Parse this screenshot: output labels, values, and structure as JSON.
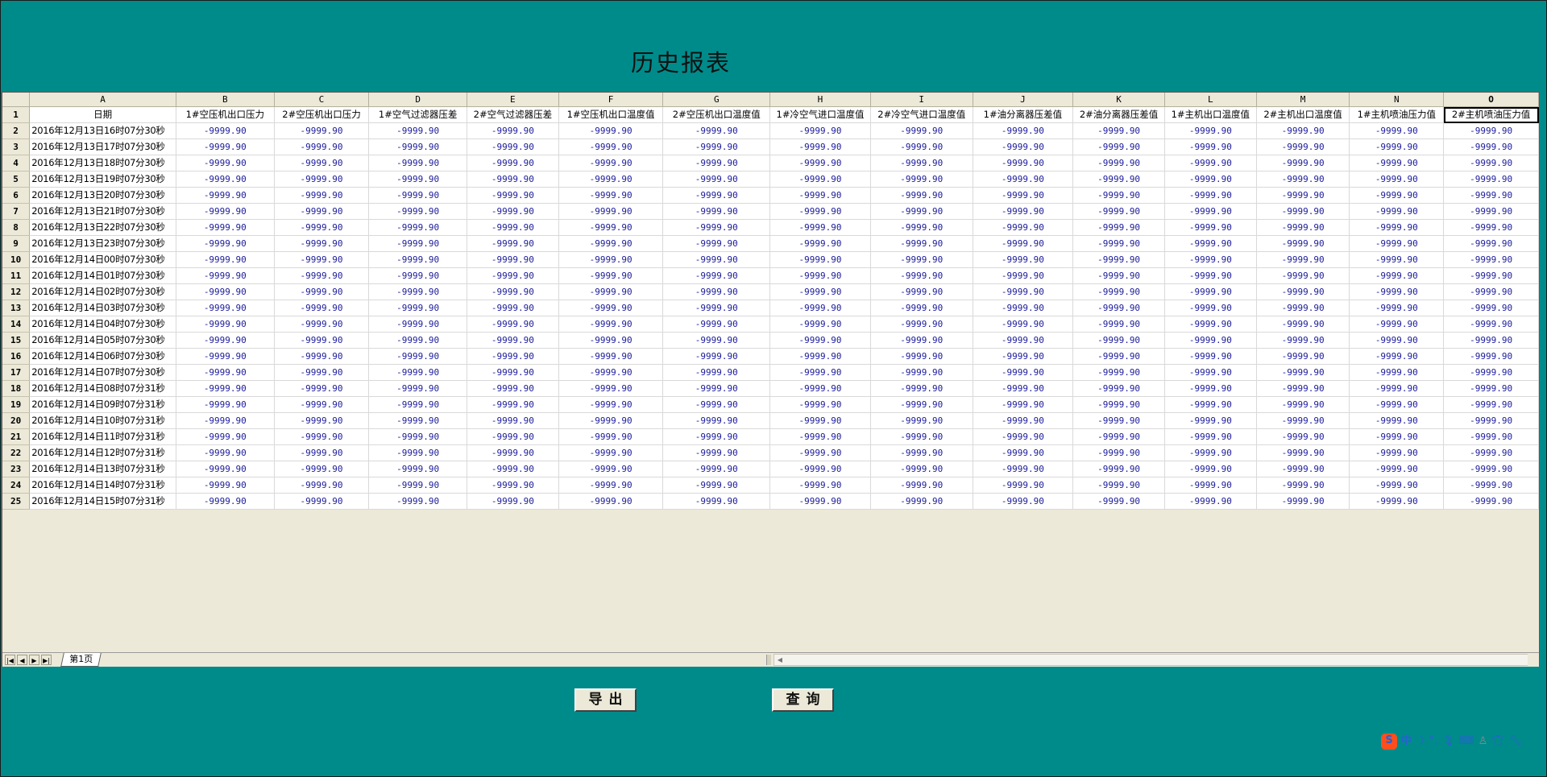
{
  "page": {
    "title": "历史报表"
  },
  "sheet": {
    "column_letters": [
      "A",
      "B",
      "C",
      "D",
      "E",
      "F",
      "G",
      "H",
      "I",
      "J",
      "K",
      "L",
      "M",
      "N",
      "O"
    ],
    "headers": [
      "日期",
      "1#空压机出口压力",
      "2#空压机出口压力",
      "1#空气过滤器压差",
      "2#空气过滤器压差",
      "1#空压机出口温度值",
      "2#空压机出口温度值",
      "1#冷空气进口温度值",
      "2#冷空气进口温度值",
      "1#油分离器压差值",
      "2#油分离器压差值",
      "1#主机出口温度值",
      "2#主机出口温度值",
      "1#主机喷油压力值",
      "2#主机喷油压力值"
    ],
    "rows": [
      {
        "num": "2",
        "date": "2016年12月13日16时07分30秒",
        "values": [
          "-9999.90",
          "-9999.90",
          "-9999.90",
          "-9999.90",
          "-9999.90",
          "-9999.90",
          "-9999.90",
          "-9999.90",
          "-9999.90",
          "-9999.90",
          "-9999.90",
          "-9999.90",
          "-9999.90",
          "-9999.90"
        ]
      },
      {
        "num": "3",
        "date": "2016年12月13日17时07分30秒",
        "values": [
          "-9999.90",
          "-9999.90",
          "-9999.90",
          "-9999.90",
          "-9999.90",
          "-9999.90",
          "-9999.90",
          "-9999.90",
          "-9999.90",
          "-9999.90",
          "-9999.90",
          "-9999.90",
          "-9999.90",
          "-9999.90"
        ]
      },
      {
        "num": "4",
        "date": "2016年12月13日18时07分30秒",
        "values": [
          "-9999.90",
          "-9999.90",
          "-9999.90",
          "-9999.90",
          "-9999.90",
          "-9999.90",
          "-9999.90",
          "-9999.90",
          "-9999.90",
          "-9999.90",
          "-9999.90",
          "-9999.90",
          "-9999.90",
          "-9999.90"
        ]
      },
      {
        "num": "5",
        "date": "2016年12月13日19时07分30秒",
        "values": [
          "-9999.90",
          "-9999.90",
          "-9999.90",
          "-9999.90",
          "-9999.90",
          "-9999.90",
          "-9999.90",
          "-9999.90",
          "-9999.90",
          "-9999.90",
          "-9999.90",
          "-9999.90",
          "-9999.90",
          "-9999.90"
        ]
      },
      {
        "num": "6",
        "date": "2016年12月13日20时07分30秒",
        "values": [
          "-9999.90",
          "-9999.90",
          "-9999.90",
          "-9999.90",
          "-9999.90",
          "-9999.90",
          "-9999.90",
          "-9999.90",
          "-9999.90",
          "-9999.90",
          "-9999.90",
          "-9999.90",
          "-9999.90",
          "-9999.90"
        ]
      },
      {
        "num": "7",
        "date": "2016年12月13日21时07分30秒",
        "values": [
          "-9999.90",
          "-9999.90",
          "-9999.90",
          "-9999.90",
          "-9999.90",
          "-9999.90",
          "-9999.90",
          "-9999.90",
          "-9999.90",
          "-9999.90",
          "-9999.90",
          "-9999.90",
          "-9999.90",
          "-9999.90"
        ]
      },
      {
        "num": "8",
        "date": "2016年12月13日22时07分30秒",
        "values": [
          "-9999.90",
          "-9999.90",
          "-9999.90",
          "-9999.90",
          "-9999.90",
          "-9999.90",
          "-9999.90",
          "-9999.90",
          "-9999.90",
          "-9999.90",
          "-9999.90",
          "-9999.90",
          "-9999.90",
          "-9999.90"
        ]
      },
      {
        "num": "9",
        "date": "2016年12月13日23时07分30秒",
        "values": [
          "-9999.90",
          "-9999.90",
          "-9999.90",
          "-9999.90",
          "-9999.90",
          "-9999.90",
          "-9999.90",
          "-9999.90",
          "-9999.90",
          "-9999.90",
          "-9999.90",
          "-9999.90",
          "-9999.90",
          "-9999.90"
        ]
      },
      {
        "num": "10",
        "date": "2016年12月14日00时07分30秒",
        "values": [
          "-9999.90",
          "-9999.90",
          "-9999.90",
          "-9999.90",
          "-9999.90",
          "-9999.90",
          "-9999.90",
          "-9999.90",
          "-9999.90",
          "-9999.90",
          "-9999.90",
          "-9999.90",
          "-9999.90",
          "-9999.90"
        ]
      },
      {
        "num": "11",
        "date": "2016年12月14日01时07分30秒",
        "values": [
          "-9999.90",
          "-9999.90",
          "-9999.90",
          "-9999.90",
          "-9999.90",
          "-9999.90",
          "-9999.90",
          "-9999.90",
          "-9999.90",
          "-9999.90",
          "-9999.90",
          "-9999.90",
          "-9999.90",
          "-9999.90"
        ]
      },
      {
        "num": "12",
        "date": "2016年12月14日02时07分30秒",
        "values": [
          "-9999.90",
          "-9999.90",
          "-9999.90",
          "-9999.90",
          "-9999.90",
          "-9999.90",
          "-9999.90",
          "-9999.90",
          "-9999.90",
          "-9999.90",
          "-9999.90",
          "-9999.90",
          "-9999.90",
          "-9999.90"
        ]
      },
      {
        "num": "13",
        "date": "2016年12月14日03时07分30秒",
        "values": [
          "-9999.90",
          "-9999.90",
          "-9999.90",
          "-9999.90",
          "-9999.90",
          "-9999.90",
          "-9999.90",
          "-9999.90",
          "-9999.90",
          "-9999.90",
          "-9999.90",
          "-9999.90",
          "-9999.90",
          "-9999.90"
        ]
      },
      {
        "num": "14",
        "date": "2016年12月14日04时07分30秒",
        "values": [
          "-9999.90",
          "-9999.90",
          "-9999.90",
          "-9999.90",
          "-9999.90",
          "-9999.90",
          "-9999.90",
          "-9999.90",
          "-9999.90",
          "-9999.90",
          "-9999.90",
          "-9999.90",
          "-9999.90",
          "-9999.90"
        ]
      },
      {
        "num": "15",
        "date": "2016年12月14日05时07分30秒",
        "values": [
          "-9999.90",
          "-9999.90",
          "-9999.90",
          "-9999.90",
          "-9999.90",
          "-9999.90",
          "-9999.90",
          "-9999.90",
          "-9999.90",
          "-9999.90",
          "-9999.90",
          "-9999.90",
          "-9999.90",
          "-9999.90"
        ]
      },
      {
        "num": "16",
        "date": "2016年12月14日06时07分30秒",
        "values": [
          "-9999.90",
          "-9999.90",
          "-9999.90",
          "-9999.90",
          "-9999.90",
          "-9999.90",
          "-9999.90",
          "-9999.90",
          "-9999.90",
          "-9999.90",
          "-9999.90",
          "-9999.90",
          "-9999.90",
          "-9999.90"
        ]
      },
      {
        "num": "17",
        "date": "2016年12月14日07时07分30秒",
        "values": [
          "-9999.90",
          "-9999.90",
          "-9999.90",
          "-9999.90",
          "-9999.90",
          "-9999.90",
          "-9999.90",
          "-9999.90",
          "-9999.90",
          "-9999.90",
          "-9999.90",
          "-9999.90",
          "-9999.90",
          "-9999.90"
        ]
      },
      {
        "num": "18",
        "date": "2016年12月14日08时07分31秒",
        "values": [
          "-9999.90",
          "-9999.90",
          "-9999.90",
          "-9999.90",
          "-9999.90",
          "-9999.90",
          "-9999.90",
          "-9999.90",
          "-9999.90",
          "-9999.90",
          "-9999.90",
          "-9999.90",
          "-9999.90",
          "-9999.90"
        ]
      },
      {
        "num": "19",
        "date": "2016年12月14日09时07分31秒",
        "values": [
          "-9999.90",
          "-9999.90",
          "-9999.90",
          "-9999.90",
          "-9999.90",
          "-9999.90",
          "-9999.90",
          "-9999.90",
          "-9999.90",
          "-9999.90",
          "-9999.90",
          "-9999.90",
          "-9999.90",
          "-9999.90"
        ]
      },
      {
        "num": "20",
        "date": "2016年12月14日10时07分31秒",
        "values": [
          "-9999.90",
          "-9999.90",
          "-9999.90",
          "-9999.90",
          "-9999.90",
          "-9999.90",
          "-9999.90",
          "-9999.90",
          "-9999.90",
          "-9999.90",
          "-9999.90",
          "-9999.90",
          "-9999.90",
          "-9999.90"
        ]
      },
      {
        "num": "21",
        "date": "2016年12月14日11时07分31秒",
        "values": [
          "-9999.90",
          "-9999.90",
          "-9999.90",
          "-9999.90",
          "-9999.90",
          "-9999.90",
          "-9999.90",
          "-9999.90",
          "-9999.90",
          "-9999.90",
          "-9999.90",
          "-9999.90",
          "-9999.90",
          "-9999.90"
        ]
      },
      {
        "num": "22",
        "date": "2016年12月14日12时07分31秒",
        "values": [
          "-9999.90",
          "-9999.90",
          "-9999.90",
          "-9999.90",
          "-9999.90",
          "-9999.90",
          "-9999.90",
          "-9999.90",
          "-9999.90",
          "-9999.90",
          "-9999.90",
          "-9999.90",
          "-9999.90",
          "-9999.90"
        ]
      },
      {
        "num": "23",
        "date": "2016年12月14日13时07分31秒",
        "values": [
          "-9999.90",
          "-9999.90",
          "-9999.90",
          "-9999.90",
          "-9999.90",
          "-9999.90",
          "-9999.90",
          "-9999.90",
          "-9999.90",
          "-9999.90",
          "-9999.90",
          "-9999.90",
          "-9999.90",
          "-9999.90"
        ]
      },
      {
        "num": "24",
        "date": "2016年12月14日14时07分31秒",
        "values": [
          "-9999.90",
          "-9999.90",
          "-9999.90",
          "-9999.90",
          "-9999.90",
          "-9999.90",
          "-9999.90",
          "-9999.90",
          "-9999.90",
          "-9999.90",
          "-9999.90",
          "-9999.90",
          "-9999.90",
          "-9999.90"
        ]
      },
      {
        "num": "25",
        "date": "2016年12月14日15时07分31秒",
        "values": [
          "-9999.90",
          "-9999.90",
          "-9999.90",
          "-9999.90",
          "-9999.90",
          "-9999.90",
          "-9999.90",
          "-9999.90",
          "-9999.90",
          "-9999.90",
          "-9999.90",
          "-9999.90",
          "-9999.90",
          "-9999.90"
        ]
      }
    ],
    "tabs": [
      {
        "label": "第1页"
      }
    ],
    "nav_icons": [
      "first-sheet-icon",
      "prev-sheet-icon",
      "next-sheet-icon",
      "last-sheet-icon"
    ]
  },
  "actions": {
    "export_label": "导出",
    "query_label": "查询"
  },
  "ime_toolbar": {
    "lang_label": "中",
    "icons": [
      "sogou-logo-icon",
      "moon-icon",
      "punctuation-icon",
      "microphone-icon",
      "keyboard-icon",
      "user-icon",
      "skin-icon",
      "wrench-icon"
    ]
  },
  "colors": {
    "background": "#008b8b",
    "sheet_bg": "#ece9d8",
    "value_text": "#1a1a9a",
    "ime_logo": "#ff4e1b"
  }
}
